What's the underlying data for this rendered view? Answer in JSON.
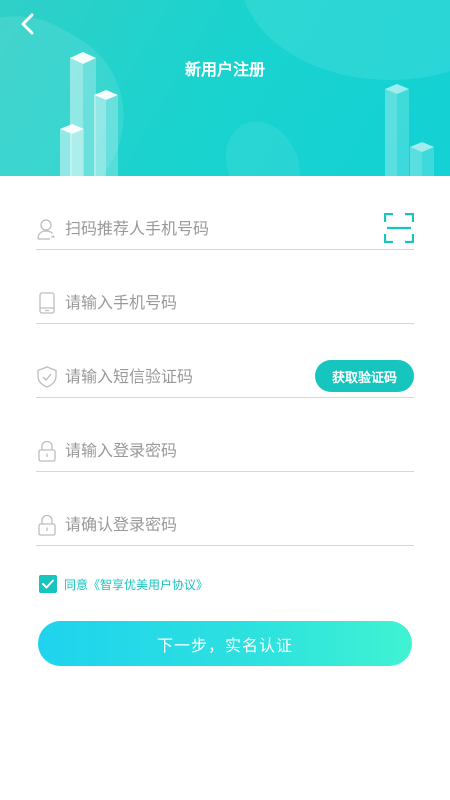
{
  "header": {
    "title": "新用户注册",
    "back_icon": "chevron-left-icon"
  },
  "form": {
    "referrer": {
      "placeholder": "扫码推荐人手机号码",
      "icon": "user-icon",
      "action_icon": "scan-icon"
    },
    "phone": {
      "placeholder": "请输入手机号码",
      "icon": "phone-icon"
    },
    "sms_code": {
      "placeholder": "请输入短信验证码",
      "icon": "shield-icon",
      "button_label": "获取验证码"
    },
    "password": {
      "placeholder": "请输入登录密码",
      "icon": "lock-icon"
    },
    "confirm_password": {
      "placeholder": "请确认登录密码",
      "icon": "lock-icon"
    }
  },
  "agreement": {
    "checked": true,
    "prefix": "同意",
    "link_text": "《智享优美用户协议》"
  },
  "next_button": {
    "label": "下一步，实名认证"
  },
  "colors": {
    "accent": "#17c5bf",
    "header_gradient_start": "#2fd0c7",
    "header_gradient_end": "#13d1d4",
    "button_gradient_start": "#1fd3ee",
    "button_gradient_end": "#3ff3d2",
    "placeholder": "#999999",
    "divider": "#d6d6d6"
  }
}
